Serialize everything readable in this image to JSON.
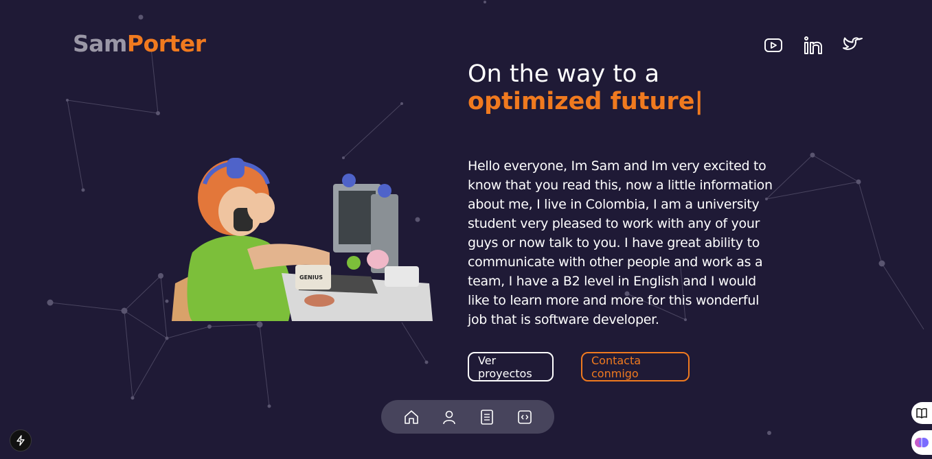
{
  "header": {
    "logo_first": "Sam",
    "logo_last": "Porter",
    "socials": [
      {
        "icon": "youtube-icon"
      },
      {
        "icon": "linkedin-icon"
      },
      {
        "icon": "twitter-icon"
      }
    ]
  },
  "hero": {
    "headline_line1": "On the way to a",
    "headline_line2": "optimized future|",
    "bio": "Hello everyone, Im Sam and Im very excited to know that you read this, now a little information about me, I live in Colombia, I am a university student very pleased to work with any of your guys or now talk to you. I have great ability to communicate with other people and work as a team, I have a B2 level in English and I would like to learn more and more for this wonderful job that is software developer.",
    "image_mug_text": "GENIUS",
    "buttons": {
      "projects": "Ver proyectos",
      "contact": "Contacta conmigo"
    }
  },
  "dock": {
    "items": [
      {
        "icon": "home-icon"
      },
      {
        "icon": "user-icon"
      },
      {
        "icon": "document-icon"
      },
      {
        "icon": "code-icon"
      }
    ]
  },
  "colors": {
    "background": "#1f1a36",
    "accent": "#f07a1f",
    "logo_gray": "#9a97a6",
    "dock": "#47445c"
  }
}
